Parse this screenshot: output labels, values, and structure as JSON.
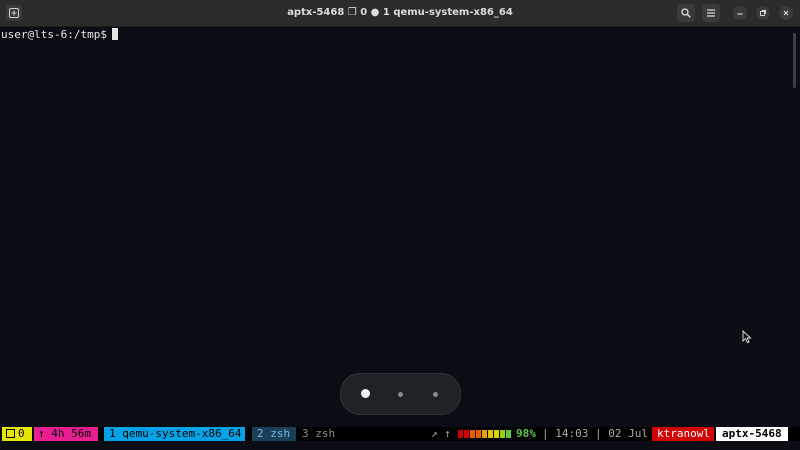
{
  "window": {
    "title": "aptx-5468 ❐ 0 ● 1 qemu-system-x86_64"
  },
  "terminal": {
    "prompt": "user@lts-6:/tmp$"
  },
  "pager": {
    "pages": 3,
    "active": 1
  },
  "status": {
    "session": "0",
    "uptime": "↑ 4h 56m",
    "window1": "1 qemu-system-x86_64",
    "window2": "2 zsh",
    "window3": "3 zsh",
    "arrows": "↗ ↑",
    "battery": "98%",
    "time": "| 14:03 | 02 Jul",
    "user": "ktranowl",
    "host": "aptx-5468",
    "load_colors": [
      "#d10000",
      "#d10000",
      "#e85d00",
      "#e85d00",
      "#e8a000",
      "#e8c400",
      "#d8d800",
      "#9ad000",
      "#5ec74a"
    ]
  },
  "colors": {
    "terminal_bg": "#0a0e14",
    "titlebar_bg": "#2b2b2b"
  }
}
